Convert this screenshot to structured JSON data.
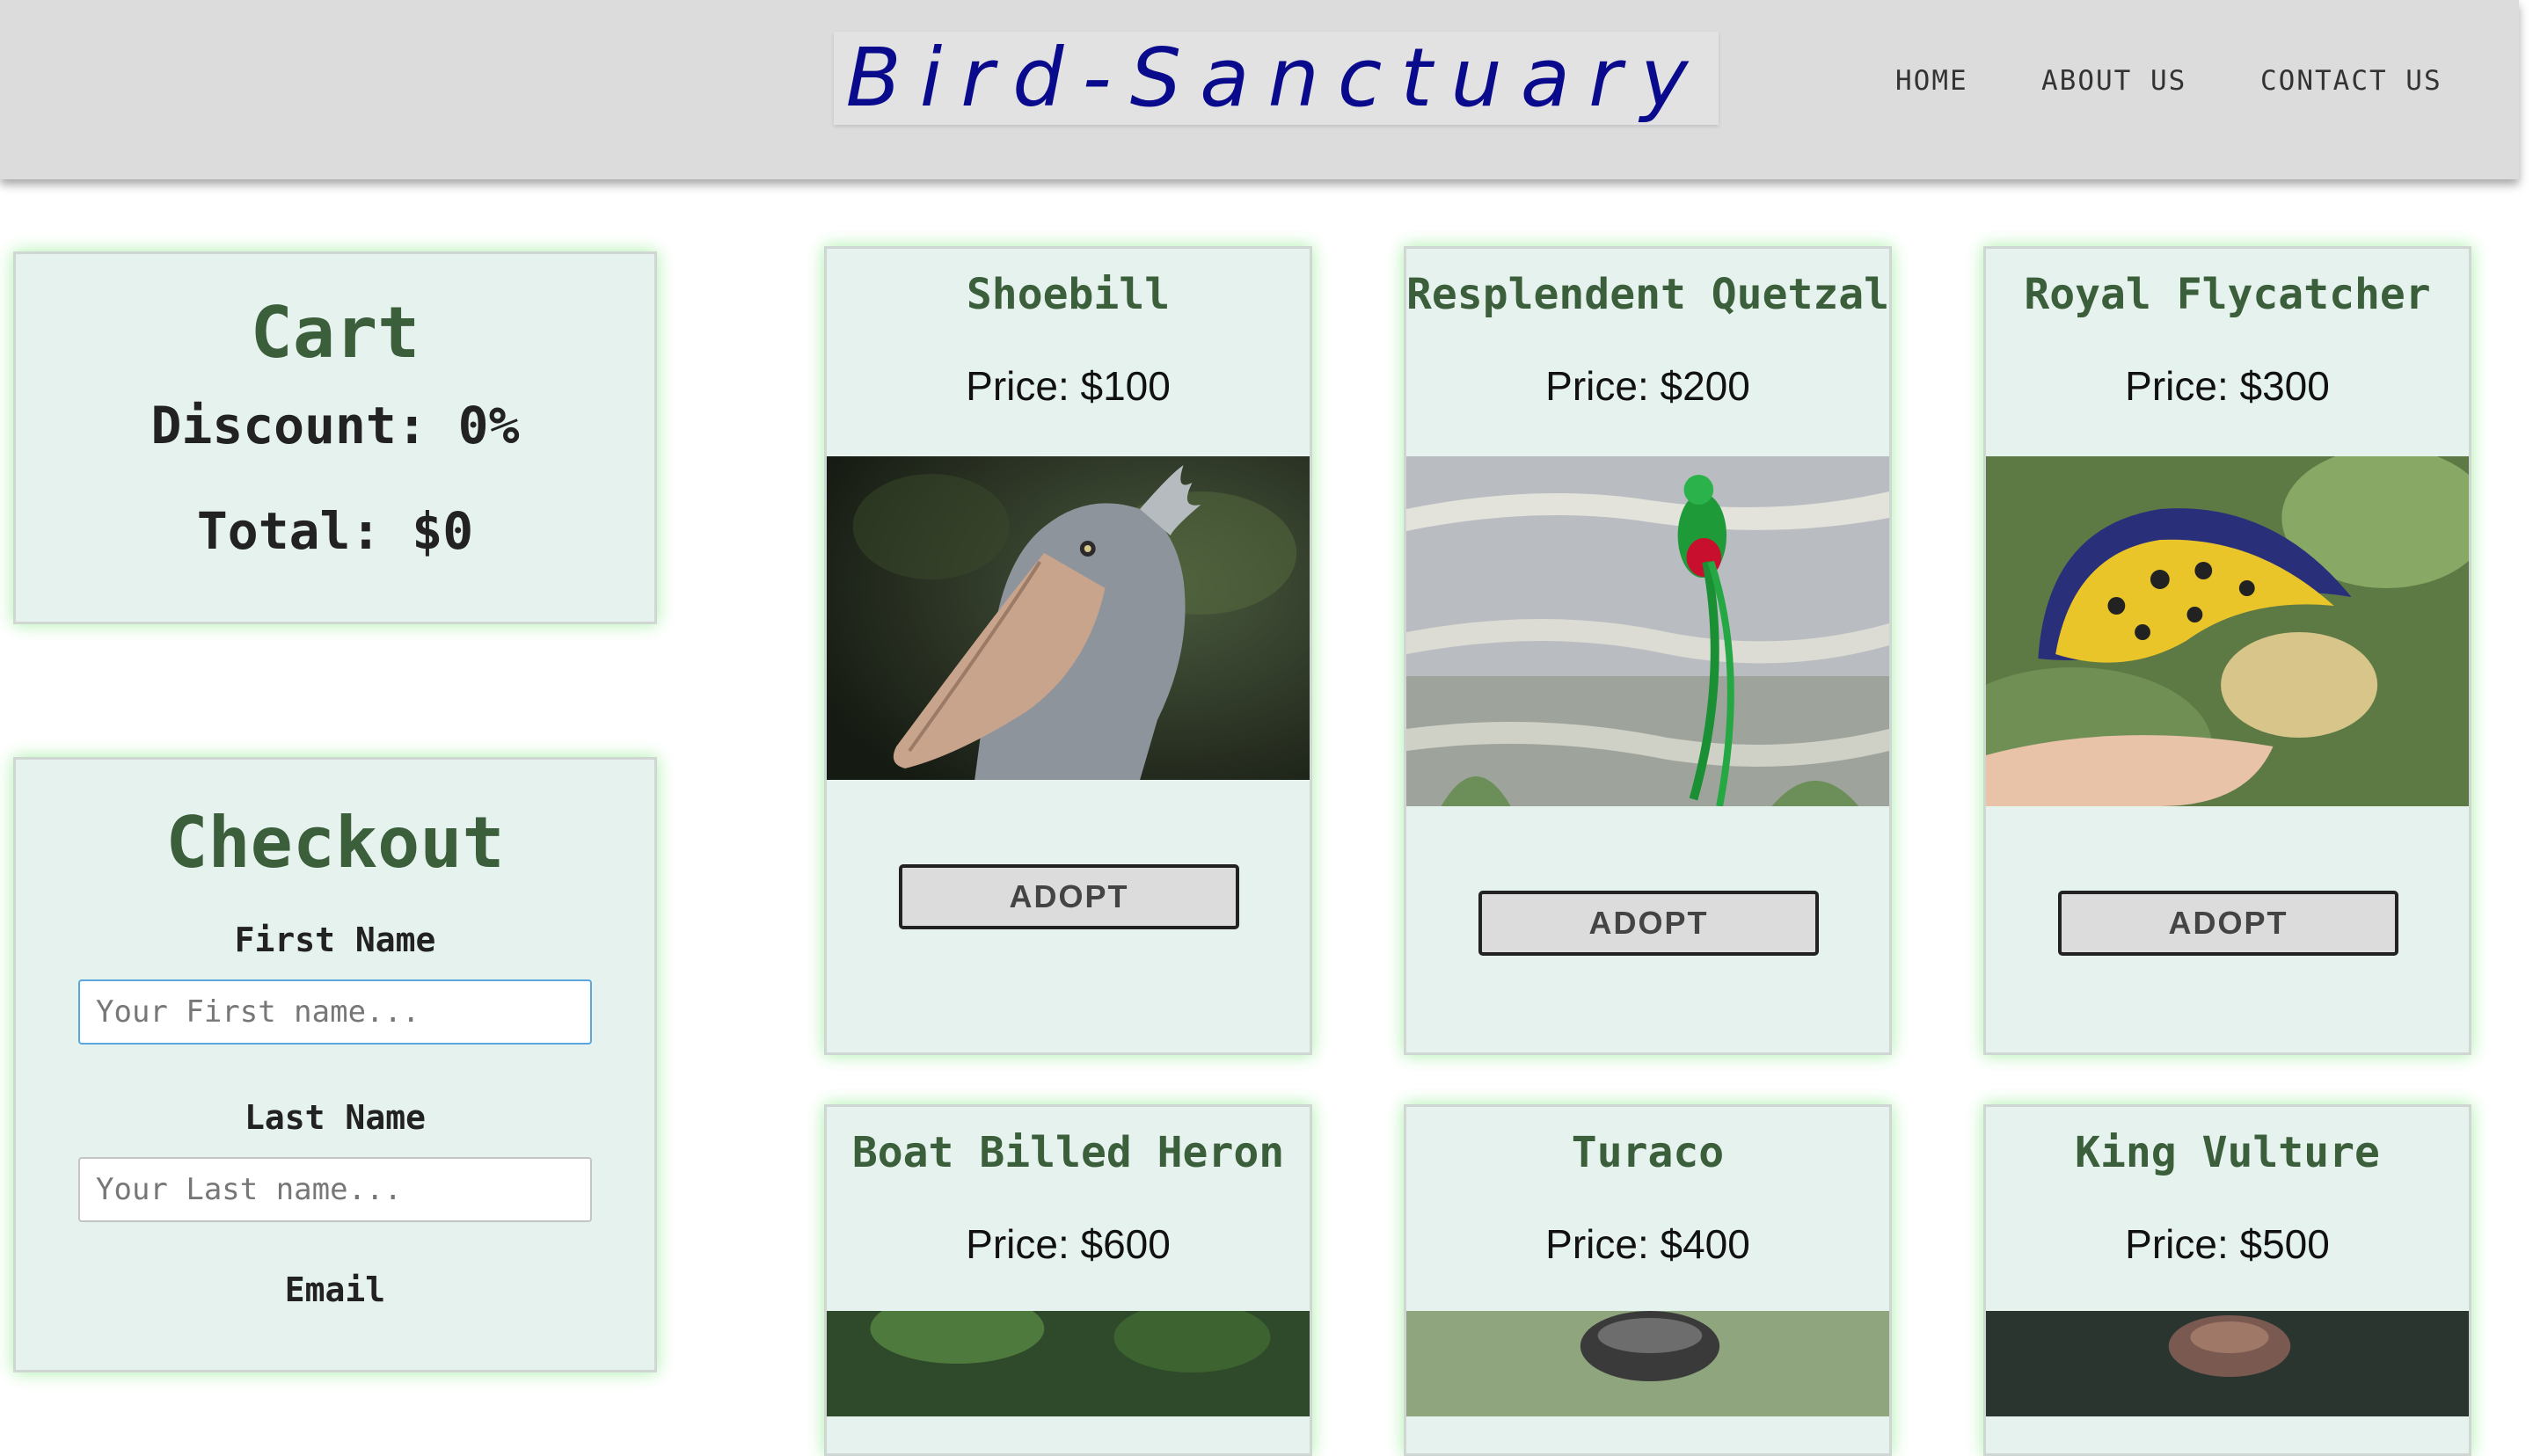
{
  "header": {
    "logo": "Bird-Sanctuary",
    "nav": [
      "HOME",
      "ABOUT US",
      "CONTACT US"
    ]
  },
  "cart": {
    "title": "Cart",
    "discount": "Discount: 0%",
    "total": "Total: $0"
  },
  "checkout": {
    "title": "Checkout",
    "first_name_label": "First Name",
    "first_name_placeholder": "Your First name...",
    "last_name_label": "Last Name",
    "last_name_placeholder": "Your Last name...",
    "email_label": "Email"
  },
  "products": [
    {
      "name": "Shoebill",
      "price": "Price: $100",
      "button": "ADOPT",
      "image": "shoebill-bird-photo"
    },
    {
      "name": "Resplendent Quetzal",
      "price": "Price: $200",
      "button": "ADOPT",
      "image": "quetzal-bird-photo"
    },
    {
      "name": "Royal Flycatcher",
      "price": "Price: $300",
      "button": "ADOPT",
      "image": "royal-flycatcher-bird-photo"
    },
    {
      "name": "Boat Billed Heron",
      "price": "Price: $600",
      "image": "boat-billed-heron-bird-photo"
    },
    {
      "name": "Turaco",
      "price": "Price: $400",
      "image": "turaco-bird-photo"
    },
    {
      "name": "King Vulture",
      "price": "Price: $500",
      "image": "king-vulture-bird-photo"
    }
  ],
  "colors": {
    "logo": "#0a0a8c",
    "card_bg": "#e6f2ee",
    "card_glow": "#8ceb8c",
    "heading_green": "#3b5e3b"
  }
}
